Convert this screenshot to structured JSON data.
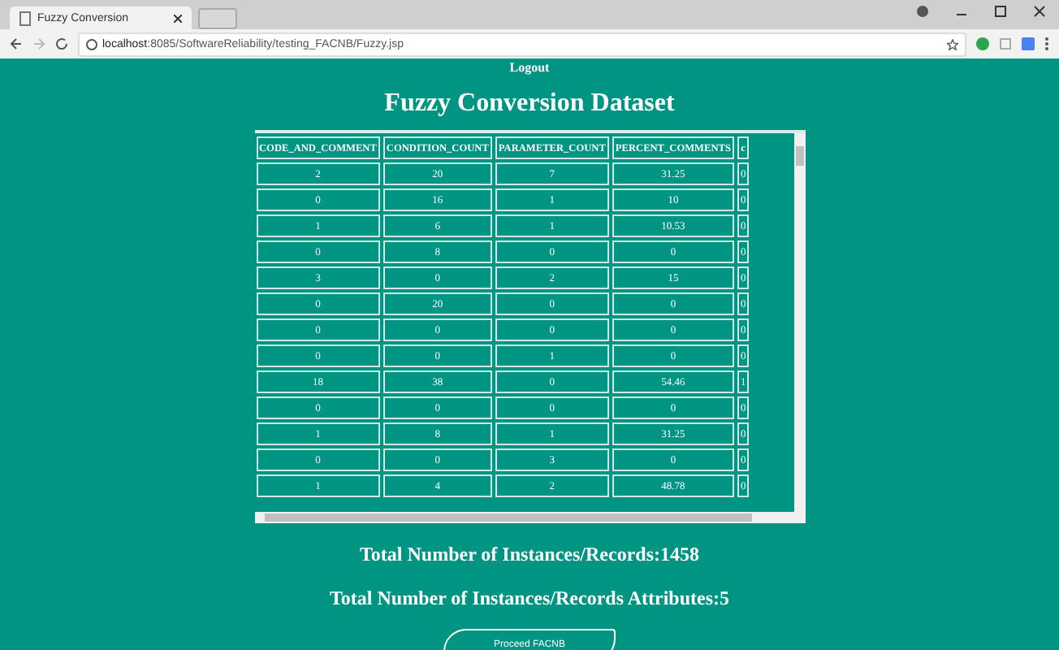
{
  "browser": {
    "tab_title": "Fuzzy Conversion",
    "url_host": "localhost",
    "url_path": ":8085/SoftwareReliability/testing_FACNB/Fuzzy.jsp"
  },
  "header": {
    "logout": "Logout",
    "title": "Fuzzy Conversion Dataset"
  },
  "table": {
    "columns": [
      "CODE_AND_COMMENT",
      "CONDITION_COUNT",
      "PARAMETER_COUNT",
      "PERCENT_COMMENTS",
      "c"
    ],
    "rows": [
      [
        "2",
        "20",
        "7",
        "31.25",
        "0"
      ],
      [
        "0",
        "16",
        "1",
        "10",
        "0"
      ],
      [
        "1",
        "6",
        "1",
        "10.53",
        "0"
      ],
      [
        "0",
        "8",
        "0",
        "0",
        "0"
      ],
      [
        "3",
        "0",
        "2",
        "15",
        "0"
      ],
      [
        "0",
        "20",
        "0",
        "0",
        "0"
      ],
      [
        "0",
        "0",
        "0",
        "0",
        "0"
      ],
      [
        "0",
        "0",
        "1",
        "0",
        "0"
      ],
      [
        "18",
        "38",
        "0",
        "54.46",
        "1"
      ],
      [
        "0",
        "0",
        "0",
        "0",
        "0"
      ],
      [
        "1",
        "8",
        "1",
        "31.25",
        "0"
      ],
      [
        "0",
        "0",
        "3",
        "0",
        "0"
      ],
      [
        "1",
        "4",
        "2",
        "48.78",
        "0"
      ]
    ]
  },
  "summary": [
    "Total Number of Instances/Records:1458",
    "Total Number of Instances/Records Attributes:5"
  ],
  "button": "Proceed FACNB"
}
